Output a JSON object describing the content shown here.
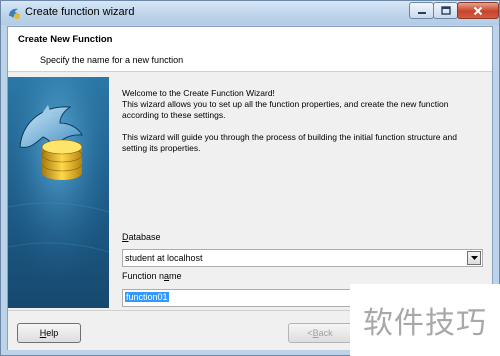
{
  "window": {
    "title": "Create function wizard",
    "icon": "dolphin-app-icon",
    "controls": [
      "minimize-icon",
      "maximize-icon",
      "close-icon"
    ]
  },
  "header": {
    "title": "Create New Function",
    "subtitle": "Specify the name for a new function"
  },
  "welcome": {
    "line1": "Welcome to the Create Function Wizard!",
    "line2": "This wizard allows you to set up all the function properties, and create the new function according to these settings.",
    "line3": "This wizard will guide you through the process of building the initial function structure and setting its properties."
  },
  "form": {
    "database_label": "Database",
    "database_accesskey": "D",
    "database_value": "student at localhost",
    "function_name_label": "Function name",
    "function_name_value": "function01"
  },
  "footer": {
    "help_label": "Help",
    "back_label": "< Back"
  },
  "watermark": "软件技巧"
}
